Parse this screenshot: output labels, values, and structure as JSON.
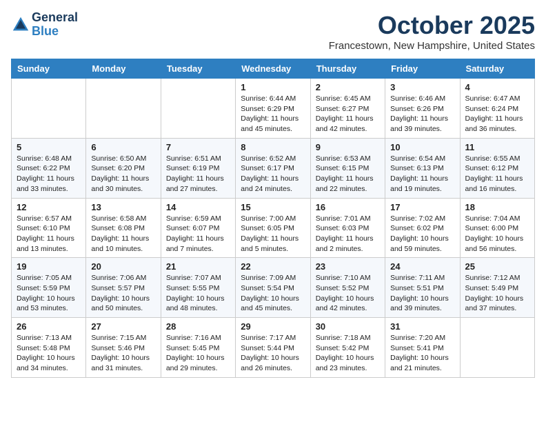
{
  "header": {
    "logo_line1": "General",
    "logo_line2": "Blue",
    "month": "October 2025",
    "location": "Francestown, New Hampshire, United States"
  },
  "days_of_week": [
    "Sunday",
    "Monday",
    "Tuesday",
    "Wednesday",
    "Thursday",
    "Friday",
    "Saturday"
  ],
  "weeks": [
    [
      {
        "num": "",
        "sunrise": "",
        "sunset": "",
        "daylight": ""
      },
      {
        "num": "",
        "sunrise": "",
        "sunset": "",
        "daylight": ""
      },
      {
        "num": "",
        "sunrise": "",
        "sunset": "",
        "daylight": ""
      },
      {
        "num": "1",
        "sunrise": "Sunrise: 6:44 AM",
        "sunset": "Sunset: 6:29 PM",
        "daylight": "Daylight: 11 hours and 45 minutes."
      },
      {
        "num": "2",
        "sunrise": "Sunrise: 6:45 AM",
        "sunset": "Sunset: 6:27 PM",
        "daylight": "Daylight: 11 hours and 42 minutes."
      },
      {
        "num": "3",
        "sunrise": "Sunrise: 6:46 AM",
        "sunset": "Sunset: 6:26 PM",
        "daylight": "Daylight: 11 hours and 39 minutes."
      },
      {
        "num": "4",
        "sunrise": "Sunrise: 6:47 AM",
        "sunset": "Sunset: 6:24 PM",
        "daylight": "Daylight: 11 hours and 36 minutes."
      }
    ],
    [
      {
        "num": "5",
        "sunrise": "Sunrise: 6:48 AM",
        "sunset": "Sunset: 6:22 PM",
        "daylight": "Daylight: 11 hours and 33 minutes."
      },
      {
        "num": "6",
        "sunrise": "Sunrise: 6:50 AM",
        "sunset": "Sunset: 6:20 PM",
        "daylight": "Daylight: 11 hours and 30 minutes."
      },
      {
        "num": "7",
        "sunrise": "Sunrise: 6:51 AM",
        "sunset": "Sunset: 6:19 PM",
        "daylight": "Daylight: 11 hours and 27 minutes."
      },
      {
        "num": "8",
        "sunrise": "Sunrise: 6:52 AM",
        "sunset": "Sunset: 6:17 PM",
        "daylight": "Daylight: 11 hours and 24 minutes."
      },
      {
        "num": "9",
        "sunrise": "Sunrise: 6:53 AM",
        "sunset": "Sunset: 6:15 PM",
        "daylight": "Daylight: 11 hours and 22 minutes."
      },
      {
        "num": "10",
        "sunrise": "Sunrise: 6:54 AM",
        "sunset": "Sunset: 6:13 PM",
        "daylight": "Daylight: 11 hours and 19 minutes."
      },
      {
        "num": "11",
        "sunrise": "Sunrise: 6:55 AM",
        "sunset": "Sunset: 6:12 PM",
        "daylight": "Daylight: 11 hours and 16 minutes."
      }
    ],
    [
      {
        "num": "12",
        "sunrise": "Sunrise: 6:57 AM",
        "sunset": "Sunset: 6:10 PM",
        "daylight": "Daylight: 11 hours and 13 minutes."
      },
      {
        "num": "13",
        "sunrise": "Sunrise: 6:58 AM",
        "sunset": "Sunset: 6:08 PM",
        "daylight": "Daylight: 11 hours and 10 minutes."
      },
      {
        "num": "14",
        "sunrise": "Sunrise: 6:59 AM",
        "sunset": "Sunset: 6:07 PM",
        "daylight": "Daylight: 11 hours and 7 minutes."
      },
      {
        "num": "15",
        "sunrise": "Sunrise: 7:00 AM",
        "sunset": "Sunset: 6:05 PM",
        "daylight": "Daylight: 11 hours and 5 minutes."
      },
      {
        "num": "16",
        "sunrise": "Sunrise: 7:01 AM",
        "sunset": "Sunset: 6:03 PM",
        "daylight": "Daylight: 11 hours and 2 minutes."
      },
      {
        "num": "17",
        "sunrise": "Sunrise: 7:02 AM",
        "sunset": "Sunset: 6:02 PM",
        "daylight": "Daylight: 10 hours and 59 minutes."
      },
      {
        "num": "18",
        "sunrise": "Sunrise: 7:04 AM",
        "sunset": "Sunset: 6:00 PM",
        "daylight": "Daylight: 10 hours and 56 minutes."
      }
    ],
    [
      {
        "num": "19",
        "sunrise": "Sunrise: 7:05 AM",
        "sunset": "Sunset: 5:59 PM",
        "daylight": "Daylight: 10 hours and 53 minutes."
      },
      {
        "num": "20",
        "sunrise": "Sunrise: 7:06 AM",
        "sunset": "Sunset: 5:57 PM",
        "daylight": "Daylight: 10 hours and 50 minutes."
      },
      {
        "num": "21",
        "sunrise": "Sunrise: 7:07 AM",
        "sunset": "Sunset: 5:55 PM",
        "daylight": "Daylight: 10 hours and 48 minutes."
      },
      {
        "num": "22",
        "sunrise": "Sunrise: 7:09 AM",
        "sunset": "Sunset: 5:54 PM",
        "daylight": "Daylight: 10 hours and 45 minutes."
      },
      {
        "num": "23",
        "sunrise": "Sunrise: 7:10 AM",
        "sunset": "Sunset: 5:52 PM",
        "daylight": "Daylight: 10 hours and 42 minutes."
      },
      {
        "num": "24",
        "sunrise": "Sunrise: 7:11 AM",
        "sunset": "Sunset: 5:51 PM",
        "daylight": "Daylight: 10 hours and 39 minutes."
      },
      {
        "num": "25",
        "sunrise": "Sunrise: 7:12 AM",
        "sunset": "Sunset: 5:49 PM",
        "daylight": "Daylight: 10 hours and 37 minutes."
      }
    ],
    [
      {
        "num": "26",
        "sunrise": "Sunrise: 7:13 AM",
        "sunset": "Sunset: 5:48 PM",
        "daylight": "Daylight: 10 hours and 34 minutes."
      },
      {
        "num": "27",
        "sunrise": "Sunrise: 7:15 AM",
        "sunset": "Sunset: 5:46 PM",
        "daylight": "Daylight: 10 hours and 31 minutes."
      },
      {
        "num": "28",
        "sunrise": "Sunrise: 7:16 AM",
        "sunset": "Sunset: 5:45 PM",
        "daylight": "Daylight: 10 hours and 29 minutes."
      },
      {
        "num": "29",
        "sunrise": "Sunrise: 7:17 AM",
        "sunset": "Sunset: 5:44 PM",
        "daylight": "Daylight: 10 hours and 26 minutes."
      },
      {
        "num": "30",
        "sunrise": "Sunrise: 7:18 AM",
        "sunset": "Sunset: 5:42 PM",
        "daylight": "Daylight: 10 hours and 23 minutes."
      },
      {
        "num": "31",
        "sunrise": "Sunrise: 7:20 AM",
        "sunset": "Sunset: 5:41 PM",
        "daylight": "Daylight: 10 hours and 21 minutes."
      },
      {
        "num": "",
        "sunrise": "",
        "sunset": "",
        "daylight": ""
      }
    ]
  ]
}
